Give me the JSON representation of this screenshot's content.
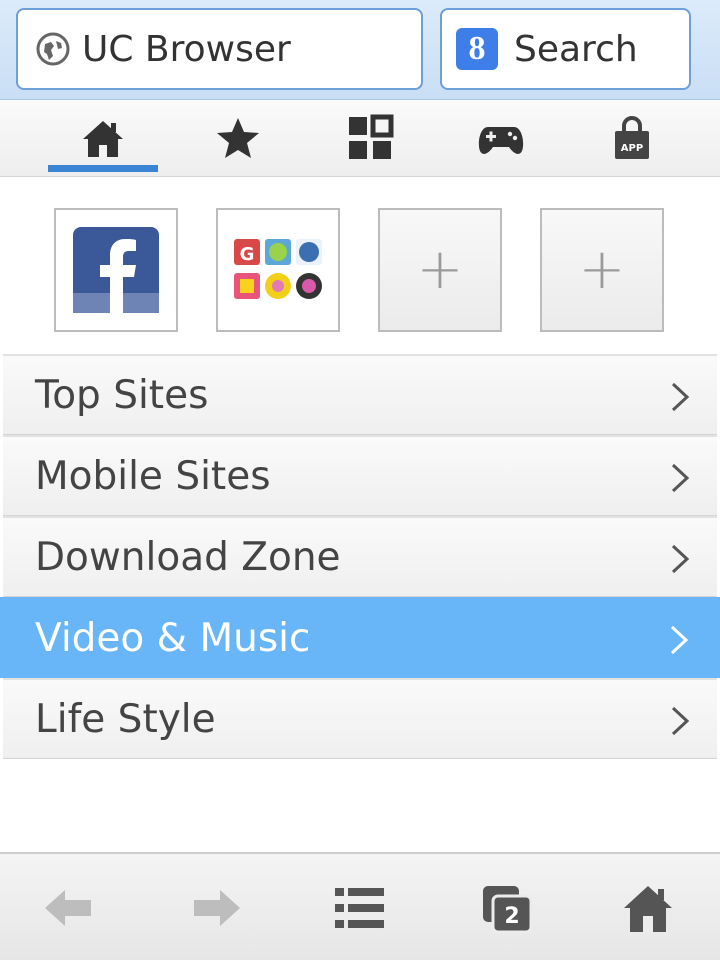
{
  "topbar": {
    "address": {
      "text": "UC Browser",
      "icon": "globe-icon"
    },
    "search": {
      "label": "Search",
      "icon": "google-g-icon",
      "icon_glyph": "8"
    }
  },
  "tabs": [
    {
      "name": "home",
      "icon": "home-icon",
      "active": true
    },
    {
      "name": "bookmarks",
      "icon": "star-icon",
      "active": false
    },
    {
      "name": "apps-grid",
      "icon": "grid-icon",
      "active": false
    },
    {
      "name": "games",
      "icon": "gamepad-icon",
      "active": false
    },
    {
      "name": "app-store",
      "icon": "app-bag-icon",
      "badge_text": "APP",
      "active": false
    }
  ],
  "shortcuts": [
    {
      "name": "facebook",
      "icon": "facebook-icon",
      "glyph": "f"
    },
    {
      "name": "apps-folder",
      "icon": "app-folder-icon"
    },
    {
      "name": "add-1",
      "icon": "plus-icon",
      "glyph": "+"
    },
    {
      "name": "add-2",
      "icon": "plus-icon",
      "glyph": "+"
    }
  ],
  "categories": [
    {
      "label": "Top Sites",
      "selected": false
    },
    {
      "label": "Mobile Sites",
      "selected": false
    },
    {
      "label": "Download Zone",
      "selected": false
    },
    {
      "label": "Video & Music",
      "selected": true
    },
    {
      "label": "Life Style",
      "selected": false
    }
  ],
  "bottom_toolbar": [
    {
      "name": "back",
      "icon": "back-arrow-icon"
    },
    {
      "name": "forward",
      "icon": "forward-arrow-icon"
    },
    {
      "name": "menu",
      "icon": "menu-list-icon"
    },
    {
      "name": "windows",
      "icon": "windows-icon",
      "count": "2"
    },
    {
      "name": "home",
      "icon": "home-icon"
    }
  ],
  "colors": {
    "accent": "#3a84d6",
    "selected_row": "#68b6f7",
    "topbar_bg": "#d4e6f8",
    "facebook_blue": "#3b5998"
  }
}
